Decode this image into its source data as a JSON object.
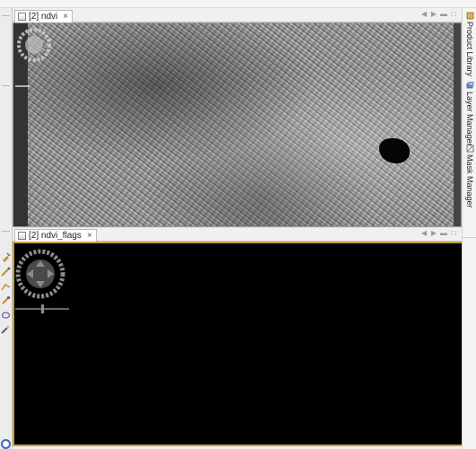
{
  "tabs": {
    "top": {
      "label": "[2] ndvi",
      "close": "×"
    },
    "bottom": {
      "label": "[2] ndvi_flags",
      "close": "×"
    }
  },
  "nav_controls": {
    "prev": "◀",
    "next": "▶",
    "minimize": "▬",
    "maximize": "□"
  },
  "right_panel": {
    "items": [
      {
        "label": "Product Library",
        "icon": "product-library-icon"
      },
      {
        "label": "Layer Manager",
        "icon": "layer-manager-icon"
      },
      {
        "label": "Mask Manager",
        "icon": "mask-manager-icon"
      }
    ]
  },
  "colors": {
    "selected_view_border": "#c8a13a",
    "view_background": "#000000"
  }
}
